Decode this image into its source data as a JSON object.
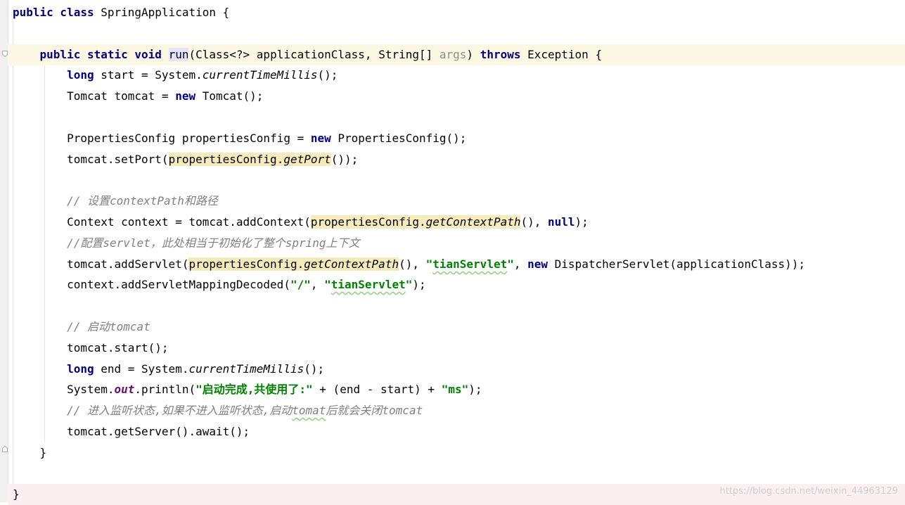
{
  "editor": {
    "lines": [
      {
        "parts": [
          {
            "t": "public class",
            "c": "kw"
          },
          {
            "t": " SpringApplication {"
          }
        ]
      },
      {
        "parts": []
      },
      {
        "parts": [
          {
            "t": "    "
          },
          {
            "t": "public static void",
            "c": "kw"
          },
          {
            "t": " "
          },
          {
            "t": "run",
            "c": "sel"
          },
          {
            "t": "(Class<?> applicationClass, String[] "
          },
          {
            "t": "args",
            "c": "param"
          },
          {
            "t": ") "
          },
          {
            "t": "throws",
            "c": "kw"
          },
          {
            "t": " Exception {"
          }
        ]
      },
      {
        "parts": [
          {
            "t": "        "
          },
          {
            "t": "long",
            "c": "kw"
          },
          {
            "t": " start = System."
          },
          {
            "t": "currentTimeMillis",
            "c": "it"
          },
          {
            "t": "();"
          }
        ]
      },
      {
        "parts": [
          {
            "t": "        Tomcat tomcat = "
          },
          {
            "t": "new",
            "c": "kw"
          },
          {
            "t": " Tomcat();"
          }
        ]
      },
      {
        "parts": []
      },
      {
        "parts": [
          {
            "t": "        PropertiesConfig propertiesConfig = "
          },
          {
            "t": "new",
            "c": "kw"
          },
          {
            "t": " PropertiesConfig();"
          }
        ]
      },
      {
        "parts": [
          {
            "t": "        tomcat.setPort("
          },
          {
            "t": "propertiesConfig.",
            "c": "hl"
          },
          {
            "t": "getPort",
            "c": "hl it"
          },
          {
            "t": "());"
          }
        ]
      },
      {
        "parts": []
      },
      {
        "parts": [
          {
            "t": "        "
          },
          {
            "t": "// 设置contextPath和路径",
            "c": "cm"
          }
        ]
      },
      {
        "parts": [
          {
            "t": "        Context context = tomcat.addContext("
          },
          {
            "t": "propertiesConfig.",
            "c": "hl"
          },
          {
            "t": "getContextPath",
            "c": "hl it"
          },
          {
            "t": "(), "
          },
          {
            "t": "null",
            "c": "kw"
          },
          {
            "t": ");"
          }
        ]
      },
      {
        "parts": [
          {
            "t": "        "
          },
          {
            "t": "//配置servlet，此处相当于初始化了整个spring上下文",
            "c": "cm"
          }
        ]
      },
      {
        "parts": [
          {
            "t": "        tomcat.addServlet("
          },
          {
            "t": "propertiesConfig.",
            "c": "hl"
          },
          {
            "t": "getContextPath",
            "c": "hl it"
          },
          {
            "t": "(), "
          },
          {
            "t": "\"",
            "c": "str"
          },
          {
            "t": "tianServlet",
            "c": "str typo"
          },
          {
            "t": "\"",
            "c": "str"
          },
          {
            "t": ", "
          },
          {
            "t": "new",
            "c": "kw"
          },
          {
            "t": " DispatcherServlet(applicationClass));"
          }
        ]
      },
      {
        "parts": [
          {
            "t": "        context.addServletMappingDecoded("
          },
          {
            "t": "\"/\"",
            "c": "str"
          },
          {
            "t": ", "
          },
          {
            "t": "\"",
            "c": "str"
          },
          {
            "t": "tianServlet",
            "c": "str typo"
          },
          {
            "t": "\"",
            "c": "str"
          },
          {
            "t": ");"
          }
        ]
      },
      {
        "parts": []
      },
      {
        "parts": [
          {
            "t": "        "
          },
          {
            "t": "// 启动tomcat",
            "c": "cm"
          }
        ]
      },
      {
        "parts": [
          {
            "t": "        tomcat.start();"
          }
        ]
      },
      {
        "parts": [
          {
            "t": "        "
          },
          {
            "t": "long",
            "c": "kw"
          },
          {
            "t": " end = System."
          },
          {
            "t": "currentTimeMillis",
            "c": "it"
          },
          {
            "t": "();"
          }
        ]
      },
      {
        "parts": [
          {
            "t": "        System."
          },
          {
            "t": "out",
            "c": "field"
          },
          {
            "t": ".println("
          },
          {
            "t": "\"启动完成,共使用了:\"",
            "c": "str"
          },
          {
            "t": " + (end - start) + "
          },
          {
            "t": "\"ms\"",
            "c": "str"
          },
          {
            "t": ");"
          }
        ]
      },
      {
        "parts": [
          {
            "t": "        "
          },
          {
            "t": "// 进入监听状态,如果不进入监听状态,启动",
            "c": "cm"
          },
          {
            "t": "tomat",
            "c": "cm typo"
          },
          {
            "t": "后就会关闭tomcat",
            "c": "cm"
          }
        ]
      },
      {
        "parts": [
          {
            "t": "        tomcat.getServer().await();"
          }
        ]
      },
      {
        "parts": [
          {
            "t": "    }"
          }
        ]
      },
      {
        "parts": []
      },
      {
        "parts": [
          {
            "t": "}"
          }
        ]
      }
    ]
  },
  "watermark": "https://blog.csdn.net/weixin_44963129",
  "colors": {
    "keyword": "#000080",
    "string": "#008000",
    "comment": "#808080",
    "static_field": "#660e7a",
    "usage_highlight": "#f6ebbc",
    "current_line": "#fdf8e4"
  }
}
